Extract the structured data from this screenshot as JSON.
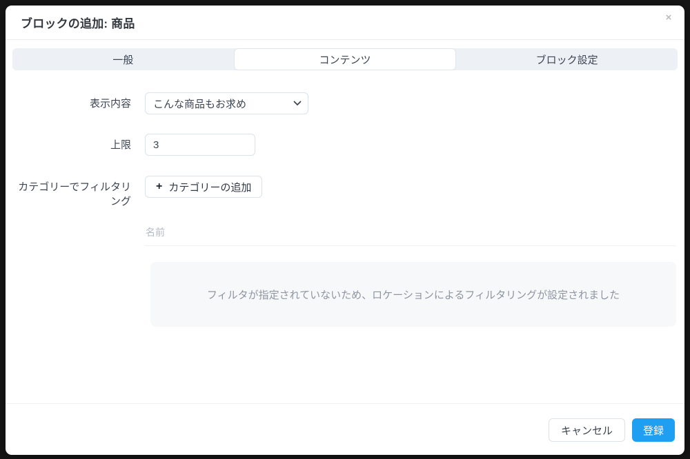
{
  "modal": {
    "title": "ブロックの追加: 商品",
    "close_icon": "×"
  },
  "tabs": [
    {
      "label": "一般",
      "active": false
    },
    {
      "label": "コンテンツ",
      "active": true
    },
    {
      "label": "ブロック設定",
      "active": false
    }
  ],
  "form": {
    "display_content": {
      "label": "表示内容",
      "value": "こんな商品もお求め"
    },
    "limit": {
      "label": "上限",
      "value": "3"
    },
    "category_filter": {
      "label": "カテゴリーでフィルタリング",
      "plus_icon": "+",
      "add_button_label": "カテゴリーの追加"
    },
    "category_table": {
      "name_header": "名前",
      "empty_message": "フィルタが指定されていないため、ロケーションによるフィルタリングが設定されました"
    }
  },
  "footer": {
    "cancel_label": "キャンセル",
    "submit_label": "登録"
  },
  "colors": {
    "accent": "#1e9ff2",
    "tab_inactive_bg": "#edf0f4",
    "empty_box_bg": "#f7f8f9"
  }
}
